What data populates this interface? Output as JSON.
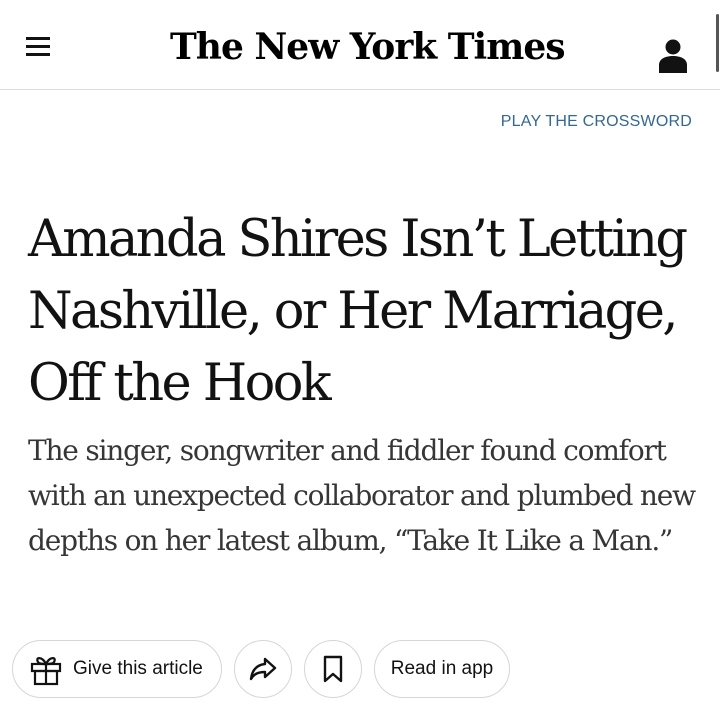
{
  "header": {
    "masthead": "The New York Times",
    "menu_icon": "hamburger-menu-icon",
    "account_icon": "user-account-icon"
  },
  "promo": {
    "crossword_link": "PLAY THE CROSSWORD"
  },
  "article": {
    "headline": "Amanda Shires Isn’t Letting Nashville, or Her Marriage, Off the Hook",
    "summary": "The singer, songwriter and fiddler found comfort with an unexpected collaborator and plumbed new depths on her latest album, “Take It Like a Man.”"
  },
  "actions": {
    "gift_label": "Give this article",
    "gift_icon": "gift-icon",
    "share_icon": "share-arrow-icon",
    "save_icon": "bookmark-icon",
    "app_label": "Read in app"
  },
  "colors": {
    "link": "#326891",
    "text": "#121212",
    "summary_text": "#363636",
    "border": "#dcdcdc"
  }
}
